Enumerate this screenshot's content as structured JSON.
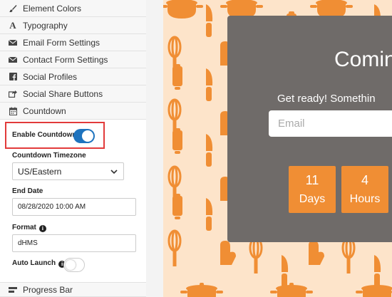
{
  "sections_top": [
    {
      "label": "Element Colors",
      "icon": "paint-brush-icon"
    },
    {
      "label": "Typography",
      "icon": "font-icon"
    },
    {
      "label": "Email Form Settings",
      "icon": "envelope-icon"
    },
    {
      "label": "Contact Form Settings",
      "icon": "envelope-icon"
    },
    {
      "label": "Social Profiles",
      "icon": "facebook-icon"
    },
    {
      "label": "Social Share Buttons",
      "icon": "share-icon"
    },
    {
      "label": "Countdown",
      "icon": "calendar-icon"
    }
  ],
  "countdown": {
    "enable_label": "Enable Countdown",
    "enabled": true,
    "timezone_label": "Countdown Timezone",
    "timezone_value": "US/Eastern",
    "end_date_label": "End Date",
    "end_date_value": "08/28/2020 10:00 AM",
    "format_label": "Format",
    "format_value": "dHMS",
    "auto_launch_label": "Auto Launch",
    "auto_launch_enabled": false
  },
  "sections_bottom": [
    {
      "label": "Progress Bar",
      "icon": "progress-icon"
    }
  ],
  "preview": {
    "title": "Comin",
    "subtitle": "Get ready! Somethin",
    "email_placeholder": "Email",
    "tiles": [
      {
        "value": "11",
        "unit": "Days"
      },
      {
        "value": "4",
        "unit": "Hours"
      }
    ]
  },
  "colors": {
    "accent": "#1e73be",
    "highlight": "#e23b3b",
    "tile": "#f08e34",
    "card": "#6f6b69",
    "preview_bg": "#fde4ca"
  }
}
